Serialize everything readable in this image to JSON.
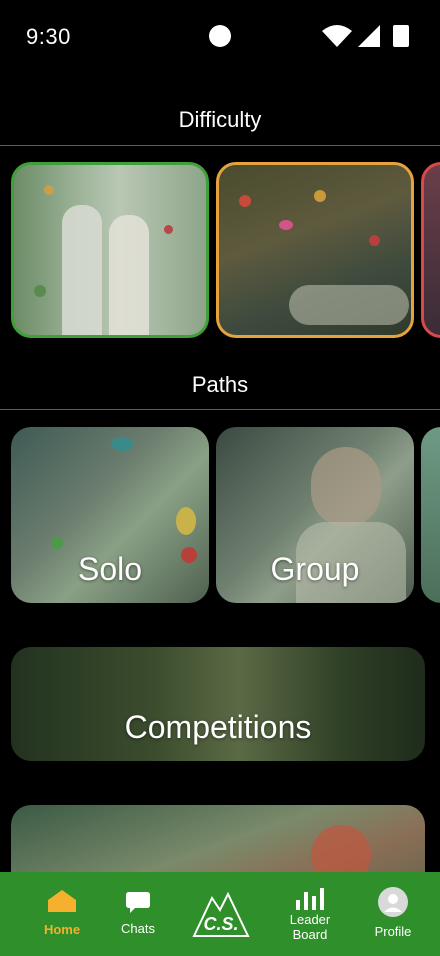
{
  "status_bar": {
    "time": "9:30"
  },
  "sections": {
    "difficulty": {
      "title": "Difficulty"
    },
    "paths": {
      "title": "Paths"
    }
  },
  "path_cards": [
    {
      "label": "Solo"
    },
    {
      "label": "Group"
    }
  ],
  "competitions": {
    "label": "Competitions"
  },
  "nav": {
    "items": [
      {
        "label": "Home"
      },
      {
        "label": "Chats"
      },
      {
        "label": "C.S."
      },
      {
        "label": "Leader",
        "label2": "Board"
      },
      {
        "label": "Profile"
      }
    ]
  },
  "colors": {
    "accent_green": "#2f8f2a",
    "active_orange": "#f5b02e",
    "card_green_border": "#3fa03a",
    "card_orange_border": "#e6a23c",
    "card_red_border": "#d84a4a"
  }
}
